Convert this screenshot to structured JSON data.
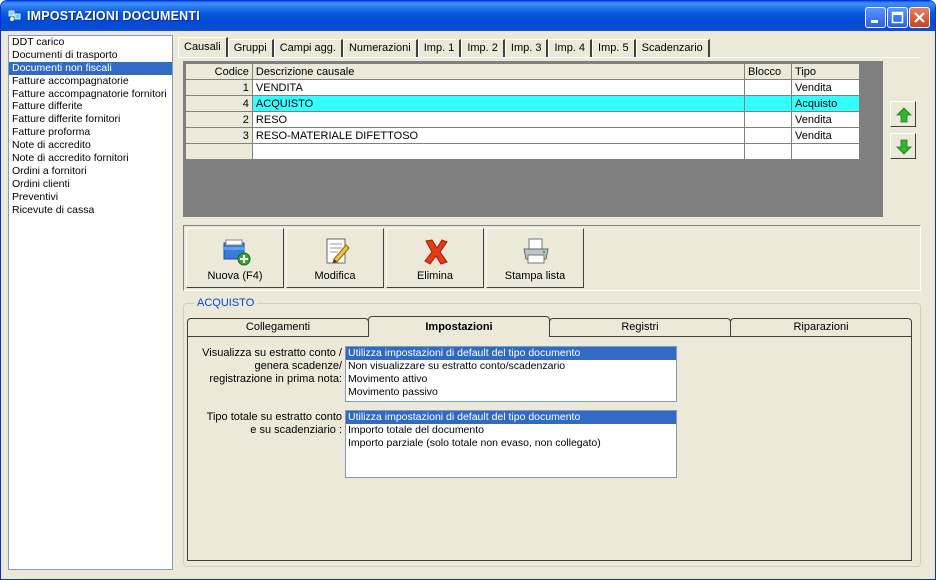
{
  "window": {
    "title": "IMPOSTAZIONI DOCUMENTI"
  },
  "left_list": {
    "selected_index": 2,
    "items": [
      "DDT carico",
      "Documenti di trasporto",
      "Documenti non fiscali",
      "Fatture accompagnatorie",
      "Fatture accompagnatorie fornitori",
      "Fatture differite",
      "Fatture differite fornitori",
      "Fatture proforma",
      "Note di accredito",
      "Note di accredito fornitori",
      "Ordini a fornitori",
      "Ordini clienti",
      "Preventivi",
      "Ricevute di cassa"
    ]
  },
  "top_tabs": {
    "active": "Causali",
    "items": [
      "Causali",
      "Gruppi",
      "Campi agg.",
      "Numerazioni",
      "Imp. 1",
      "Imp. 2",
      "Imp. 3",
      "Imp. 4",
      "Imp. 5",
      "Scadenzario"
    ]
  },
  "grid": {
    "columns": [
      "Codice",
      "Descrizione causale",
      "Blocco",
      "Tipo"
    ],
    "highlight_row": 1,
    "rows": [
      [
        "1",
        "VENDITA",
        "",
        "Vendita"
      ],
      [
        "4",
        "ACQUISTO",
        "",
        "Acquisto"
      ],
      [
        "2",
        "RESO",
        "",
        "Vendita"
      ],
      [
        "3",
        "RESO-MATERIALE DIFETTOSO",
        "",
        "Vendita"
      ],
      [
        "",
        "",
        "",
        ""
      ]
    ]
  },
  "toolbar": {
    "new_label": "Nuova (F4)",
    "edit_label": "Modifica",
    "delete_label": "Elimina",
    "print_label": "Stampa lista"
  },
  "detail": {
    "group_title": "ACQUISTO",
    "tabs": [
      "Collegamenti",
      "Impostazioni",
      "Registri",
      "Riparazioni"
    ],
    "active_tab": "Impostazioni",
    "field1": {
      "label_lines": [
        "Visualizza su estratto conto /",
        "genera scadenze/",
        "registrazione  in prima nota:"
      ],
      "selected_index": 0,
      "options": [
        "Utilizza impostazioni di default del tipo documento",
        "Non visualizzare su estratto conto/scadenzario",
        "Movimento attivo",
        "Movimento passivo"
      ]
    },
    "field2": {
      "label_lines": [
        "Tipo totale su estratto conto",
        "e su scadenziario :"
      ],
      "selected_index": 0,
      "options": [
        "Utilizza impostazioni di default del tipo documento",
        "Importo totale del documento",
        "Importo parziale (solo totale non evaso, non collegato)"
      ]
    }
  },
  "colors": {
    "title_blue": "#0a4fd6",
    "selection": "#316ac5",
    "row_highlight": "#33ffff",
    "face": "#ece9d8",
    "group_title": "#0046d5"
  }
}
